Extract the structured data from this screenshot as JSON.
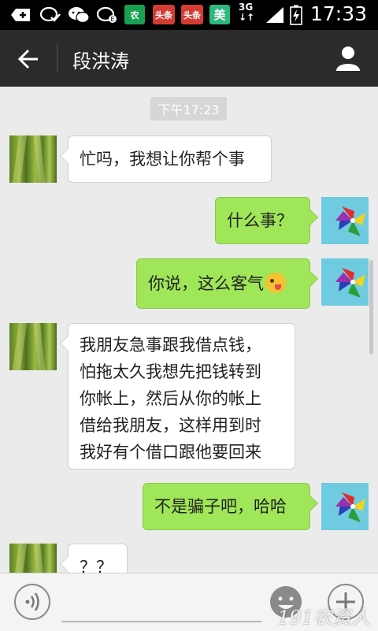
{
  "status_bar": {
    "time": "17:33",
    "network": "3G",
    "badges": [
      {
        "icon": "add-notification-icon"
      },
      {
        "icon": "wechat-check-icon"
      },
      {
        "icon": "wechat-icon"
      },
      {
        "icon": "wechat-check-icon"
      },
      {
        "text": "农",
        "color": "#1aa053"
      },
      {
        "text": "头条",
        "color": "#d43c33"
      },
      {
        "text": "头条",
        "color": "#d43c33"
      },
      {
        "text": "美",
        "color": "#2db97c"
      }
    ]
  },
  "header": {
    "title": "段洪涛",
    "back_icon": "arrow-left-icon",
    "profile_icon": "person-icon"
  },
  "chat": {
    "timestamp": "下午17:23",
    "messages": [
      {
        "side": "left",
        "text": "忙吗，我想让你帮个事"
      },
      {
        "side": "right",
        "text": "什么事？"
      },
      {
        "side": "right",
        "text": "你说，这么客气",
        "emoji": "wink-tongue-emoji"
      },
      {
        "side": "left",
        "lines": [
          "我朋友急事跟我借点钱，",
          "怕拖太久我想先把钱转到",
          "你帐上，然后从你的帐上",
          "借给我朋友，这样用到时",
          "我好有个借口跟他要回来"
        ]
      },
      {
        "side": "right",
        "text": "不是骗子吧，哈哈"
      },
      {
        "side": "left",
        "text": "？？"
      }
    ]
  },
  "input_bar": {
    "text_value": "",
    "voice_icon": "voice-icon",
    "emoji_icon": "emoji-icon",
    "plus_icon": "plus-icon"
  },
  "watermark": "191农资人",
  "colors": {
    "status_bar": "#000000",
    "title_bar": "#2b2b2b",
    "chat_bg": "#ebebeb",
    "bubble_right": "#9fe658",
    "bubble_left": "#ffffff"
  }
}
